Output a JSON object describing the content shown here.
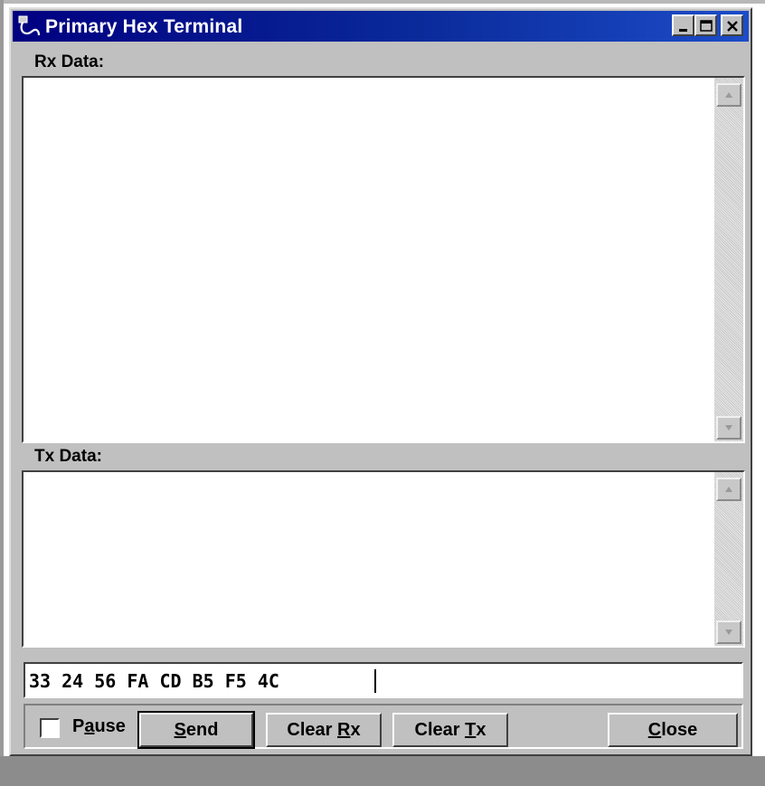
{
  "window": {
    "title": "Primary Hex Terminal",
    "controls": {
      "minimize": "minimize-icon",
      "maximize": "maximize-icon",
      "close": "close-icon"
    }
  },
  "rx": {
    "label": "Rx Data:",
    "content": ""
  },
  "tx": {
    "label": "Tx Data:",
    "content": ""
  },
  "hex_entry": {
    "value": "33 24 56 FA CD B5 F5 4C "
  },
  "controls": {
    "pause": {
      "label_pre": "P",
      "label_key": "a",
      "label_post": "use",
      "checked": false
    },
    "send": {
      "label_key": "S",
      "label_post": "end"
    },
    "clear_rx": {
      "label_pre": "Clear ",
      "label_key": "R",
      "label_post": "x"
    },
    "clear_tx": {
      "label_pre": "Clear ",
      "label_key": "T",
      "label_post": "x"
    },
    "close": {
      "label_key": "C",
      "label_post": "lose"
    }
  },
  "colors": {
    "titlebar_start": "#000080",
    "titlebar_end": "#1c4cc8",
    "face": "#c0c0c0"
  }
}
